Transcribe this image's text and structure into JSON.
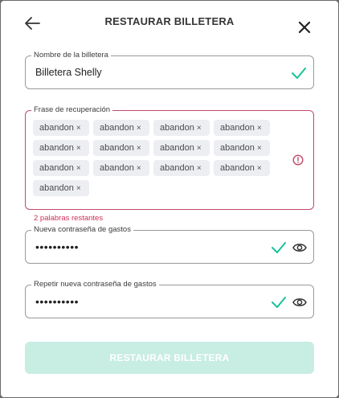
{
  "dialog": {
    "title": "RESTAURAR BILLETERA"
  },
  "wallet_name": {
    "label": "Nombre de la billetera",
    "value": "Billetera Shelly"
  },
  "recovery_phrase": {
    "label": "Frase de recuperación",
    "words": [
      "abandon",
      "abandon",
      "abandon",
      "abandon",
      "abandon",
      "abandon",
      "abandon",
      "abandon",
      "abandon",
      "abandon",
      "abandon",
      "abandon",
      "abandon"
    ],
    "remove_glyph": "×",
    "error_text": "2 palabras restantes"
  },
  "new_password": {
    "label": "Nueva contraseña de gastos",
    "value": "••••••••••"
  },
  "repeat_password": {
    "label": "Repetir nueva contraseña de gastos",
    "value": "••••••••••"
  },
  "submit_label": "RESTAURAR BILLETERA",
  "icons": {
    "back": "arrow-left-icon",
    "close": "close-icon",
    "check": "checkmark-icon",
    "eye": "eye-icon",
    "warning": "exclamation-circle-icon"
  },
  "colors": {
    "accent": "#17c29a",
    "error": "#c2496a",
    "submit_disabled": "#c8ede3"
  }
}
